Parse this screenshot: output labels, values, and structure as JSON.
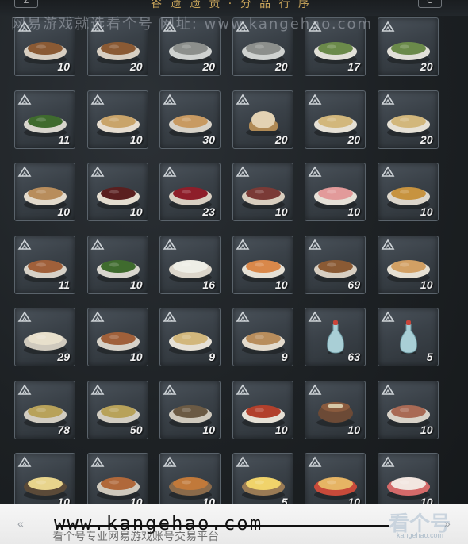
{
  "header": {
    "title": "谷 遗 遗 贡 · 分 品 行 序",
    "left_button": "Z",
    "right_button": "C"
  },
  "watermark_top": "网易游戏就选看个号  网址: www.kangehao.com",
  "footer": {
    "watermark": "www.kangehao.com",
    "subtext": "看个号专业网易游戏账号交易平台",
    "logo": "看个号",
    "logo_sub": "kangehao.com"
  },
  "colors": {
    "tile_bg": "#3a4148",
    "tile_border": "#5a636b",
    "quantity_text": "#f1f1f1",
    "title_gold": "#c9a55b"
  },
  "items": [
    {
      "name": "braised-meat-stew",
      "qty": "10",
      "icon": "stew-bowl"
    },
    {
      "name": "vegetable-stew",
      "qty": "20",
      "icon": "stew-bowl"
    },
    {
      "name": "steamed-fish",
      "qty": "20",
      "icon": "fish-plate"
    },
    {
      "name": "grilled-fish",
      "qty": "20",
      "icon": "fish-plate"
    },
    {
      "name": "green-soup",
      "qty": "17",
      "icon": "green-bowl"
    },
    {
      "name": "herb-soup",
      "qty": "20",
      "icon": "green-bowl"
    },
    {
      "name": "stir-fried-greens",
      "qty": "11",
      "icon": "greens-plate"
    },
    {
      "name": "tofu-soup",
      "qty": "10",
      "icon": "soup-bowl"
    },
    {
      "name": "flatbread-stack",
      "qty": "30",
      "icon": "bread-plate"
    },
    {
      "name": "steamed-bun",
      "qty": "20",
      "icon": "bun-basket"
    },
    {
      "name": "noodle-bowl",
      "qty": "20",
      "icon": "noodle-bowl"
    },
    {
      "name": "cold-noodles",
      "qty": "20",
      "icon": "noodle-bowl"
    },
    {
      "name": "rice-porridge",
      "qty": "10",
      "icon": "porridge-bowl"
    },
    {
      "name": "red-bean-soup",
      "qty": "10",
      "icon": "dark-soup-bowl"
    },
    {
      "name": "red-dates",
      "qty": "23",
      "icon": "dates-bowl"
    },
    {
      "name": "wine-cup",
      "qty": "10",
      "icon": "cup"
    },
    {
      "name": "sliced-fish",
      "qty": "10",
      "icon": "pink-plate"
    },
    {
      "name": "fried-rice",
      "qty": "10",
      "icon": "rice-bowl"
    },
    {
      "name": "braised-chicken",
      "qty": "11",
      "icon": "meat-plate"
    },
    {
      "name": "spinach",
      "qty": "10",
      "icon": "greens-plate"
    },
    {
      "name": "rice-dumplings",
      "qty": "16",
      "icon": "dumpling-bowl"
    },
    {
      "name": "shrimp-dish",
      "qty": "10",
      "icon": "shrimp-bowl"
    },
    {
      "name": "stewed-pork",
      "qty": "69",
      "icon": "stew-bowl"
    },
    {
      "name": "pumpkin-soup",
      "qty": "10",
      "icon": "orange-soup-bowl"
    },
    {
      "name": "tofu-plate",
      "qty": "29",
      "icon": "tofu-plate"
    },
    {
      "name": "shredded-meat",
      "qty": "10",
      "icon": "meat-plate"
    },
    {
      "name": "noodle-soup",
      "qty": "9",
      "icon": "noodle-bowl"
    },
    {
      "name": "plain-porridge",
      "qty": "9",
      "icon": "porridge-bowl"
    },
    {
      "name": "wine-flask",
      "qty": "63",
      "icon": "vase"
    },
    {
      "name": "wine-flask-small",
      "qty": "5",
      "icon": "vase"
    },
    {
      "name": "fried-noodles",
      "qty": "78",
      "icon": "noodle-plate"
    },
    {
      "name": "bean-sprouts",
      "qty": "50",
      "icon": "noodle-plate"
    },
    {
      "name": "river-snails",
      "qty": "10",
      "icon": "snail-plate"
    },
    {
      "name": "mapo-tofu",
      "qty": "10",
      "icon": "spicy-bowl"
    },
    {
      "name": "clay-pot-stew",
      "qty": "10",
      "icon": "clay-pot"
    },
    {
      "name": "braised-pork-belly",
      "qty": "10",
      "icon": "pork-plate"
    },
    {
      "name": "steamed-egg",
      "qty": "10",
      "icon": "custard-bowl"
    },
    {
      "name": "meatballs",
      "qty": "10",
      "icon": "meatball-plate"
    },
    {
      "name": "fried-cubes",
      "qty": "10",
      "icon": "cube-plate"
    },
    {
      "name": "omelette",
      "qty": "5",
      "icon": "egg-plate"
    },
    {
      "name": "layer-cake",
      "qty": "10",
      "icon": "cake-plate"
    },
    {
      "name": "peach-buns",
      "qty": "10",
      "icon": "peach-bun-plate"
    }
  ]
}
